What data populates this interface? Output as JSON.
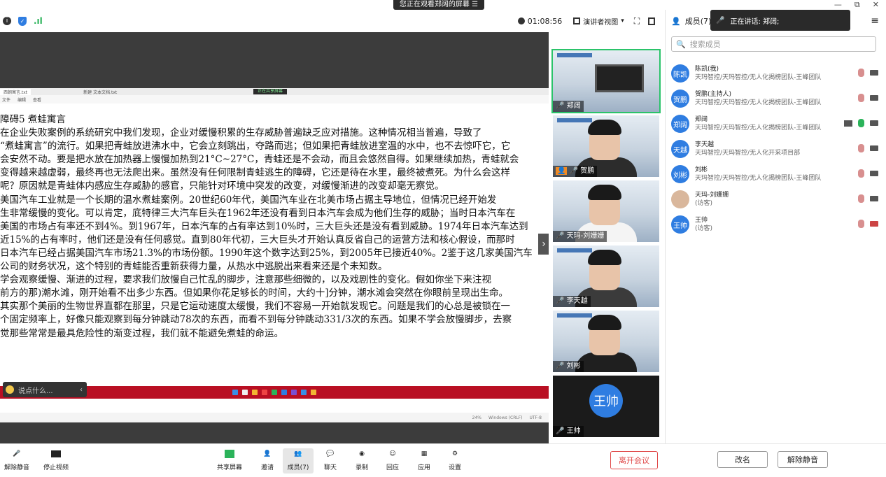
{
  "banner": {
    "text": "您正在观看郑阔的屏幕"
  },
  "window_controls": {
    "minimize": "—",
    "restore": "⧉",
    "close": "✕"
  },
  "topbar": {
    "timer": "01:08:56",
    "view_mode": "演讲者视图"
  },
  "panel": {
    "title": "成员(7)",
    "speaking_label": "正在讲话: 郑阔;",
    "search_placeholder": "搜索成员",
    "members": [
      {
        "avatar": "陈凯",
        "name": "陈凯(我)",
        "dept": "天玛智控/天玛智控/无人化揭榜团队-王峰团队",
        "avatar_color": "#2f7de1"
      },
      {
        "avatar": "贺鹏",
        "name": "贺鹏(主持人)",
        "dept": "天玛智控/天玛智控/无人化揭榜团队-王峰团队",
        "avatar_color": "#2f7de1"
      },
      {
        "avatar": "郑阔",
        "name": "郑阔",
        "dept": "天玛智控/天玛智控/无人化揭榜团队-王峰团队",
        "avatar_color": "#2f7de1"
      },
      {
        "avatar": "天越",
        "name": "李天越",
        "dept": "天玛智控/天玛智控/无人化开采项目部",
        "avatar_color": "#2f7de1"
      },
      {
        "avatar": "刘彬",
        "name": "刘彬",
        "dept": "天玛智控/天玛智控/无人化揭榜团队-王峰团队",
        "avatar_color": "#2f7de1"
      },
      {
        "avatar": "",
        "name": "天玛-刘姗姗",
        "dept": "(访客)",
        "avatar_color": "#d9b79c"
      },
      {
        "avatar": "王帅",
        "name": "王帅",
        "dept": "(访客)",
        "avatar_color": "#2f7de1"
      }
    ],
    "rename_button": "改名",
    "unmute_button": "解除静音"
  },
  "gallery": [
    {
      "name": "郑阔"
    },
    {
      "name": "贺鹏"
    },
    {
      "name": "天玛-刘姗姗"
    },
    {
      "name": "李天越"
    },
    {
      "name": "刘彬"
    },
    {
      "name": "王帅",
      "avatar": "王帅"
    }
  ],
  "shared": {
    "tab1": "西朝寓言.txt",
    "tab2": "新建 文本文档.txt",
    "sharing_pill": "正在共享屏幕",
    "menu": [
      "文件",
      "编辑",
      "查看"
    ],
    "status": [
      "24%",
      "Windows (CRLF)",
      "UTF-8"
    ],
    "chat_placeholder": "说点什么...",
    "paragraphs": [
      "障碍5  煮蛙寓言",
      "     在企业失败案例的系统研究中我们发现，企业对缓慢积累的生存威胁普遍缺乏应对措施。这种情况相当普遍，导致了",
      "“煮蛙寓言”的流行。如果把青蛙放进沸水中，它会立刻跳出，夺路而逃；但如果把青蛙放进室温的水中，也不去惊吓它，它",
      "会安然不动。要是把水放在加热器上慢慢加热到21°C~27°C，青蛙还是不会动，而且会悠然自得。如果继续加热，青蛙就会",
      "变得越来越虚弱，最终再也无法爬出来。虽然没有任何限制青蛙逃生的障碍，它还是待在水里，最终被煮死。为什么会这样",
      "呢？原因就是青蛙体内感应生存威胁的感官，只能针对环境中突发的改变，对缓慢渐进的改变却毫无察觉。",
      "     美国汽车工业就是一个长期的温水煮蛙案例。20世纪60年代，美国汽车业在北美市场占据主导地位，但情况已经开始发",
      "生非常缓慢的变化。可以肯定，底特律三大汽车巨头在1962年还没有看到日本汽车会成为他们生存的威胁；当时日本汽车在",
      "美国的市场占有率还不到4%。到1967年，日本汽车的占有率达到10%时，三大巨头还是没有看到威胁。1974年日本汽车达到",
      "近15%的占有率时，他们还是没有任何感觉。直到80年代初，三大巨头才开始认真反省自己的运营方法和核心假设，而那时",
      "日本汽车已经占据美国汽车市场21.3%的市场份额。1990年这个数字达到25%，到2005年已接近40%。2鉴于这几家美国汽车",
      "公司的财务状况，这个特别的青蛙能否重新获得力量，从热水中逃脱出来看来还是个未知数。",
      "     学会观察缓慢、渐进的过程，要求我们放慢自己忙乱的脚步，注意那些细微的，以及戏剧性的变化。假如你坐下来注视",
      "前方的那)潮水滩，刚开始看不出多少东西。但如果你花足够长的时间，大约十]分钟，潮水滩会突然在你眼前呈现出生命。",
      "其实那个美丽的生物世界直都在那里，只是它运动速度太缓慢，我们不容易一开始就发现它。问题是我们的心总是被锁在一",
      "个固定频率上，好像只能观察到每分钟跳动78次的东西，而看不到每分钟跳动331/3次的东西。如果不学会放慢脚步，去察",
      "觉那些常常是最具危险性的渐变过程，我们就不能避免煮蛙的命运。"
    ]
  },
  "bottombar": {
    "mute": "解除静音",
    "video": "停止视频",
    "share": "共享屏幕",
    "invite": "邀请",
    "members": "成员(7)",
    "chat": "聊天",
    "record": "录制",
    "react": "回应",
    "apps": "应用",
    "settings": "设置",
    "leave": "离开会议"
  }
}
